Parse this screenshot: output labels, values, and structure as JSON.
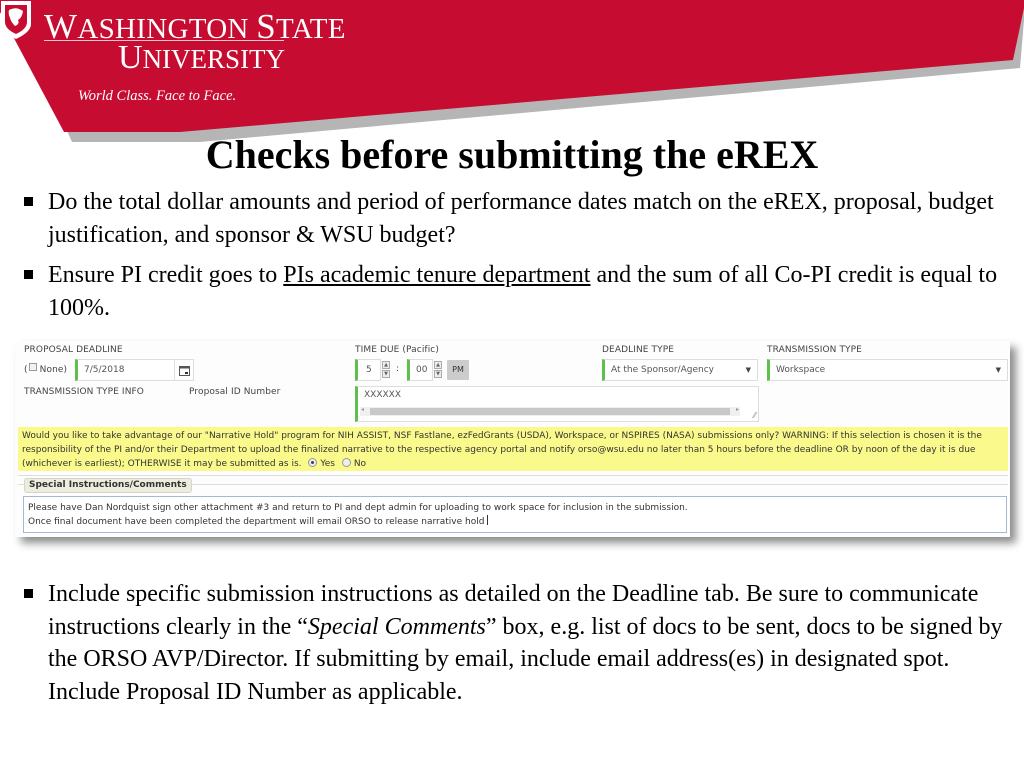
{
  "header": {
    "university_line1_cap1": "W",
    "university_line1_rest1": "ASHINGTON ",
    "university_line1_cap2": "S",
    "university_line1_rest2": "TATE",
    "university_line2_cap": "U",
    "university_line2_rest": "NIVERSITY",
    "tagline": "World Class. Face to Face.",
    "brand_color": "#c60c30",
    "shadow_color": "#b5b5b5"
  },
  "slide": {
    "title": "Checks before submitting the eREX",
    "bullets": [
      {
        "text": "Do the total dollar amounts and period of performance dates match on the eREX, proposal, budget justification, and sponsor & WSU budget?"
      },
      {
        "before": "Ensure PI credit goes to ",
        "underlined": "PIs academic tenure department",
        "after": " and the sum of all Co-PI credit is equal to 100%."
      },
      {
        "before": "Include specific submission instructions as detailed on the Deadline tab.  Be sure to communicate instructions clearly in the “",
        "italic": "Special Comments",
        "after": "” box, e.g. list of docs to be sent, docs to be signed by the ORSO AVP/Director. If submitting by email, include email address(es) in designated spot.  Include Proposal ID Number as applicable."
      }
    ]
  },
  "form": {
    "proposal_deadline_label": "PROPOSAL DEADLINE",
    "none_open": "(",
    "none_label": "None)",
    "none_checked": false,
    "deadline_date": "7/5/2018",
    "time_due_label": "TIME DUE (Pacific)",
    "hour": "5",
    "time_sep": ":",
    "minute": "00",
    "ampm": "PM",
    "deadline_type_label": "DEADLINE TYPE",
    "deadline_type_value": "At the Sponsor/Agency",
    "transmission_type_label": "TRANSMISSION TYPE",
    "transmission_type_value": "Workspace",
    "transmission_info_label": "TRANSMISSION TYPE INFO",
    "proposal_id_label": "Proposal ID Number",
    "proposal_id_value": "XXXXXX",
    "narrative_hold_text": "Would you like to take advantage of our \"Narrative Hold\" program for NIH ASSIST, NSF Fastlane, ezFedGrants (USDA), Workspace, or NSPIRES (NASA) submissions only? WARNING: If this selection is chosen it is the responsibility of the PI and/or their Department to upload the finalized narrative to the respective agency portal and notify orso@wsu.edu no later than 5 hours before the deadline OR by noon of the day it is due (whichever is earliest); OTHERWISE it may be submitted as is.",
    "yes_label": "Yes",
    "no_label": "No",
    "narrative_hold_selected": "Yes",
    "special_instructions_label": "Special Instructions/Comments",
    "comments_line1": "Please have Dan Nordquist sign other attachment #3 and return to PI and dept admin for uploading to work space for inclusion in the submission.",
    "comments_line2": "Once final document have been completed the department will email ORSO to release narrative hold",
    "required_color": "#5cc04a",
    "highlight_color": "#fafa8c"
  }
}
